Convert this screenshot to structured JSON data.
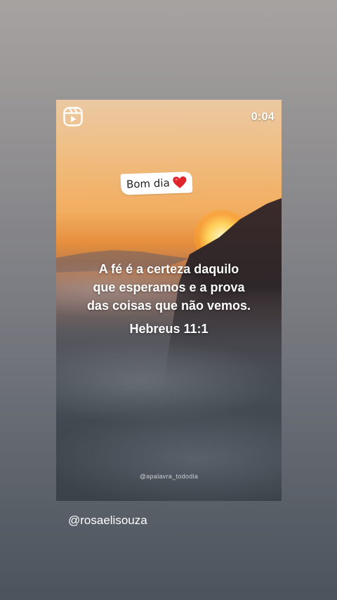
{
  "story": {
    "timer": "0:04",
    "sticker": {
      "text": "Bom dia",
      "emoji_icon": "red-heart-icon"
    },
    "verse_lines": [
      "A fé é a certeza daquilo",
      "que esperamos e a prova",
      "das coisas que não vemos."
    ],
    "reference": "Hebreus 11:1",
    "watermark": "@apalavra_tododia",
    "reel_icon": "reels-icon"
  },
  "mention": "@rosaelisouza",
  "colors": {
    "text": "#ffffff",
    "heart": "#e0242b",
    "sticker_bg": "#ffffff"
  }
}
